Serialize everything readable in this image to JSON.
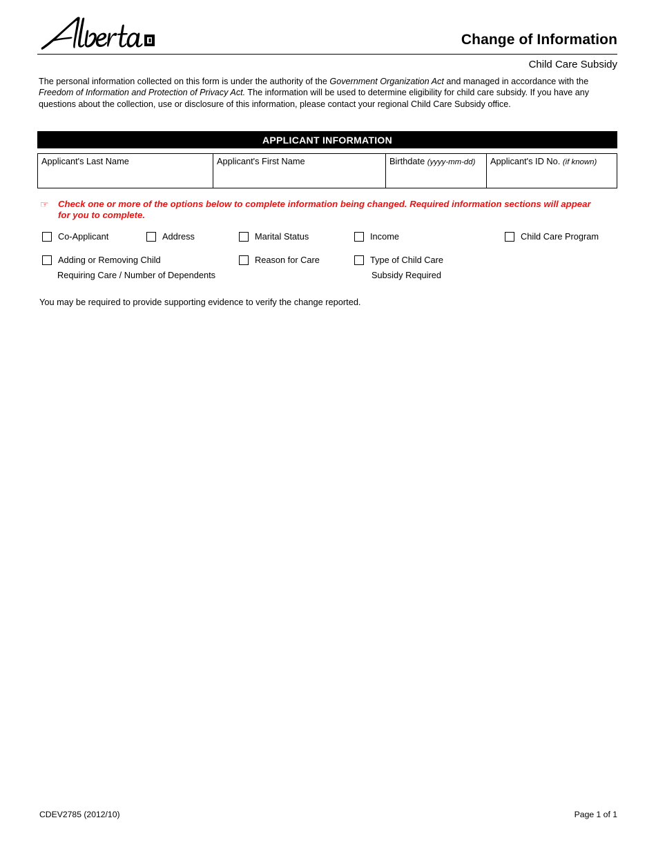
{
  "header": {
    "logo_alt": "Alberta",
    "title": "Change of Information",
    "subtitle": "Child Care Subsidy"
  },
  "privacy": {
    "part1": "The personal information collected on this form is under the authority of the ",
    "em1": "Government Organization Act",
    "part2": " and managed in accordance with the ",
    "em2": "Freedom of Information and Protection of Privacy Act.",
    "part3": " The information will be used to determine eligibility for child care subsidy. If you have any questions about the collection, use or disclosure of this information, please contact your regional Child Care Subsidy office."
  },
  "section": {
    "applicant_information": "APPLICANT INFORMATION"
  },
  "applicant_table": {
    "columns": [
      {
        "label": "Applicant's Last Name",
        "hint": "",
        "value": ""
      },
      {
        "label": "Applicant's First Name",
        "hint": "",
        "value": ""
      },
      {
        "label": "Birthdate",
        "hint": "(yyyy-mm-dd)",
        "value": ""
      },
      {
        "label": "Applicant's ID No.",
        "hint": "(if known)",
        "value": ""
      }
    ]
  },
  "instruction": {
    "icon": "☞",
    "text": "Check one or more of the options below to complete information being changed.  Required information sections will appear for you to complete.",
    "color": "#ee1111"
  },
  "options": {
    "row1": [
      {
        "label": "Co-Applicant",
        "checked": false
      },
      {
        "label": "Address",
        "checked": false
      },
      {
        "label": "Marital Status",
        "checked": false
      },
      {
        "label": "Income",
        "checked": false
      },
      {
        "label": "Child Care Program",
        "checked": false
      }
    ],
    "row2": [
      {
        "label": "Adding or Removing Child",
        "sublabel": "Requiring Care / Number of Dependents",
        "checked": false
      },
      {
        "label": "Reason for Care",
        "sublabel": "",
        "checked": false
      },
      {
        "label": "Type of Child Care",
        "sublabel": "Subsidy Required",
        "checked": false
      }
    ]
  },
  "evidence_note": "You may be required to provide supporting evidence to verify the change reported.",
  "footer": {
    "form_code": "CDEV2785 (2012/10)",
    "page_label": "Page 1 of 1"
  }
}
